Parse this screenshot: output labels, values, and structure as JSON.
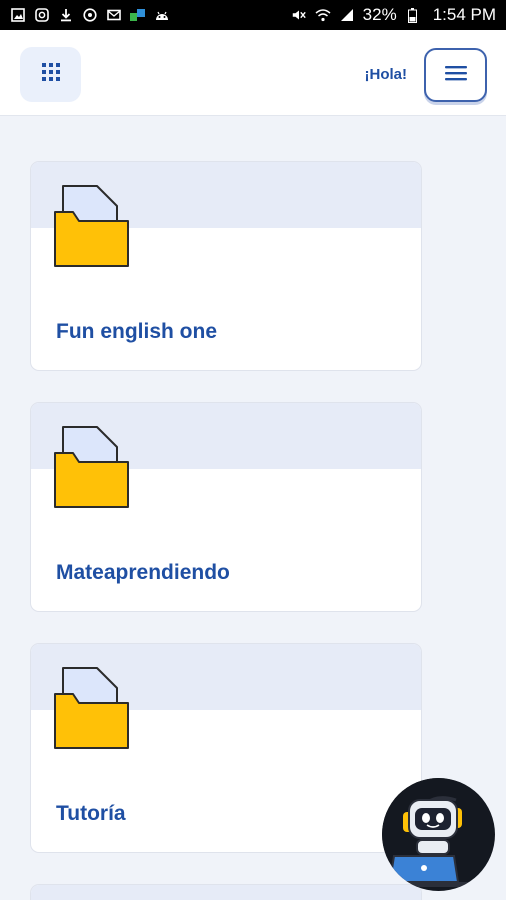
{
  "status_bar": {
    "battery": "32%",
    "time": "1:54 PM",
    "left_icons": [
      "gallery-icon",
      "instagram-icon",
      "download-icon",
      "vpn-icon",
      "mail-icon",
      "app-icon",
      "android-icon"
    ],
    "right_icons": [
      "mute-icon",
      "wifi-icon",
      "signal-icon",
      "battery-icon"
    ]
  },
  "header": {
    "greeting": "¡Hola!",
    "apps_icon": "grid-icon",
    "menu_icon": "hamburger-icon"
  },
  "cards": [
    {
      "title": "Fun english one",
      "icon": "folder-icon"
    },
    {
      "title": "Mateaprendiendo",
      "icon": "folder-icon"
    },
    {
      "title": "Tutoría",
      "icon": "folder-icon"
    }
  ],
  "bot": {
    "icon": "robot-assistant-icon"
  },
  "colors": {
    "accent": "#1f4fa3",
    "background": "#f0f3f9",
    "card_band": "#e6ebf7",
    "folder": "#ffc107"
  }
}
